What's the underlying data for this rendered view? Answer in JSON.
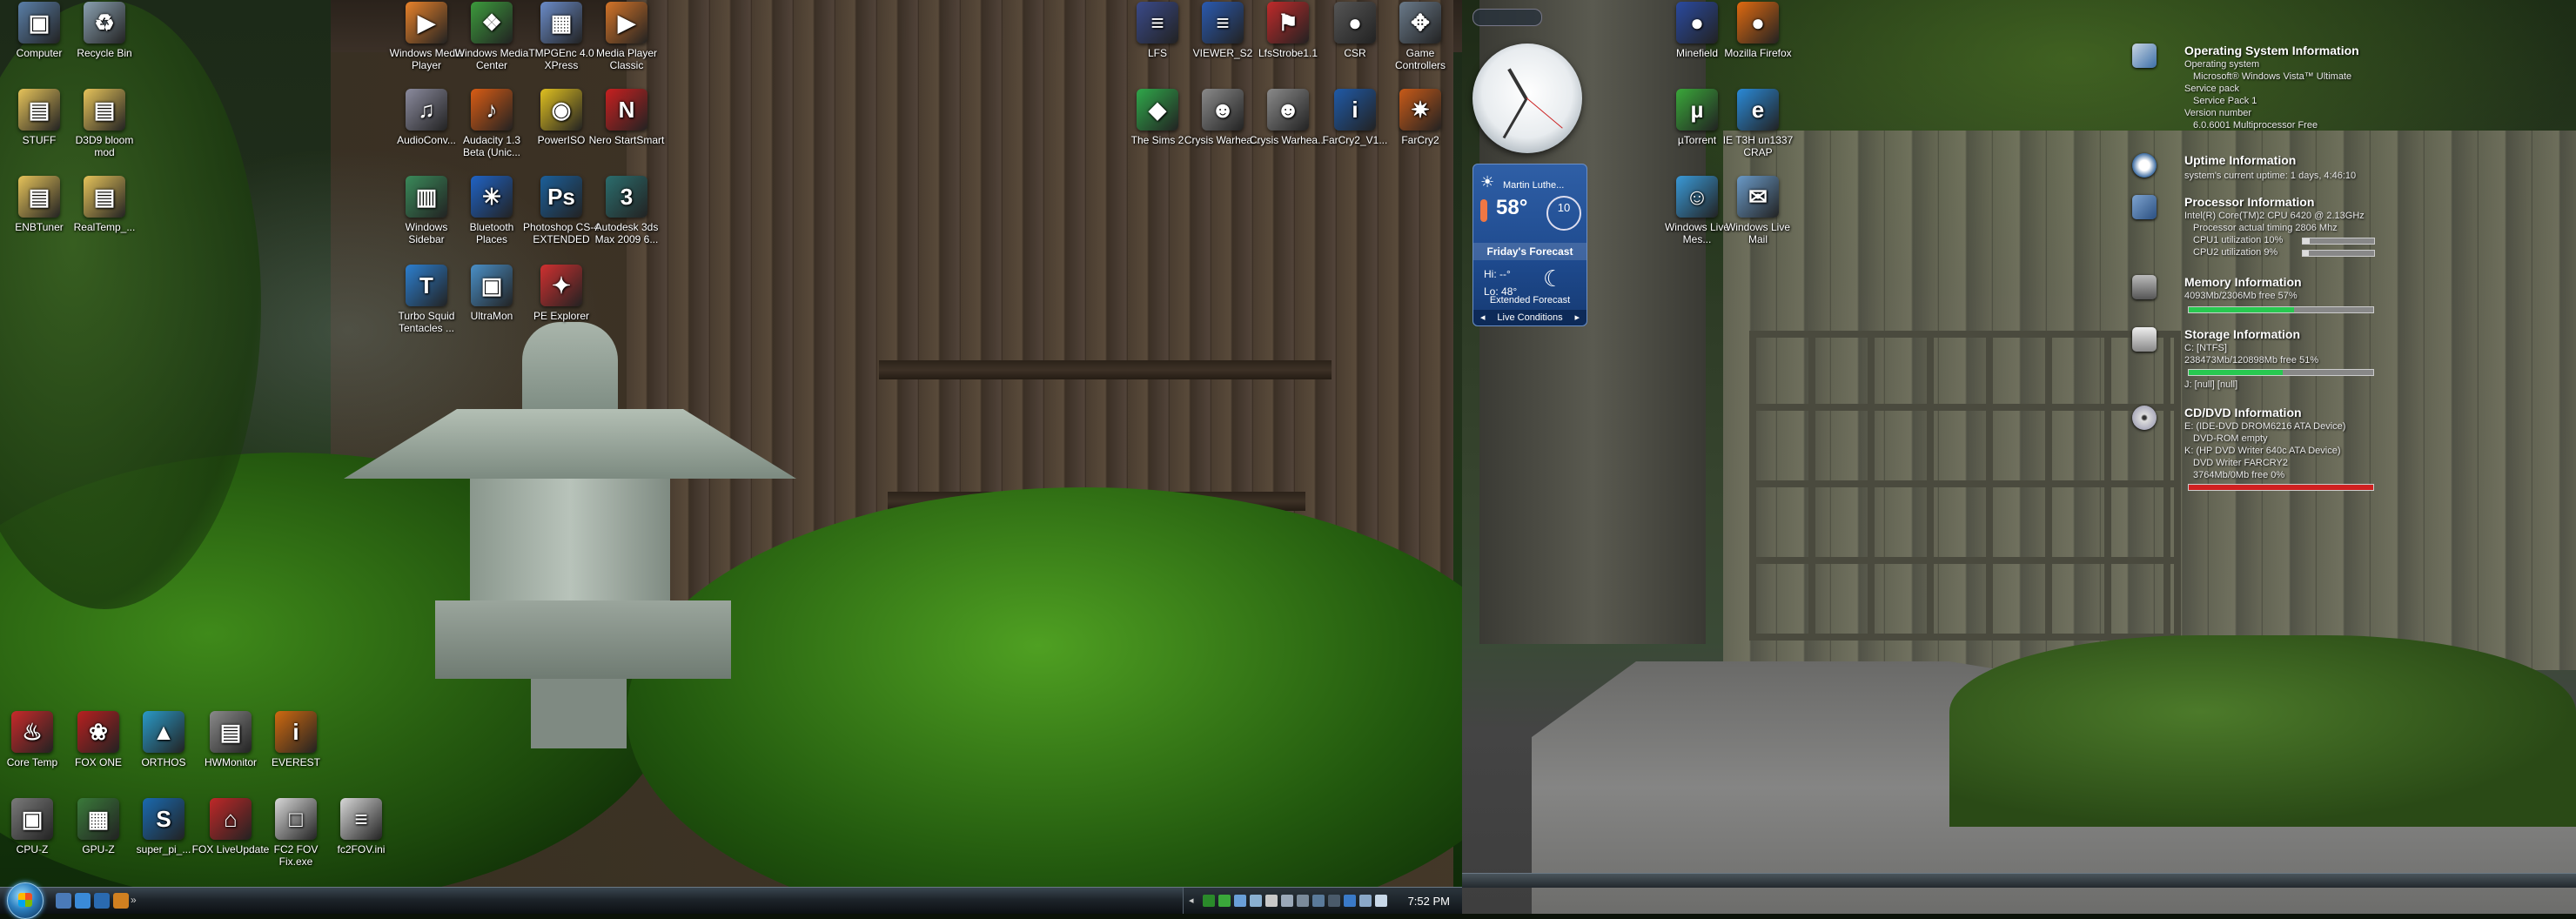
{
  "left_desktop": {
    "icons": [
      {
        "label": "Computer",
        "glyph": "▣",
        "color": "#5a7fa8"
      },
      {
        "label": "Recycle Bin",
        "glyph": "♻",
        "color": "#8aa0b0"
      },
      {
        "label": "STUFF",
        "glyph": "▤",
        "color": "#e6c35a"
      },
      {
        "label": "D3D9 bloom mod",
        "glyph": "▤",
        "color": "#e6c35a"
      },
      {
        "label": "ENBTuner",
        "glyph": "▤",
        "color": "#e6c35a"
      },
      {
        "label": "RealTemp_...",
        "glyph": "▤",
        "color": "#e6c35a"
      },
      {
        "label": "Windows Media Player",
        "glyph": "▶",
        "color": "#e8822a"
      },
      {
        "label": "Windows Media Center",
        "glyph": "❖",
        "color": "#3c9b3c"
      },
      {
        "label": "TMPGEnc 4.0 XPress",
        "glyph": "▦",
        "color": "#6b8cc9"
      },
      {
        "label": "Media Player Classic",
        "glyph": "▶",
        "color": "#d47428"
      },
      {
        "label": "AudioConv...",
        "glyph": "♫",
        "color": "#8b8b9e"
      },
      {
        "label": "Audacity 1.3 Beta (Unic...",
        "glyph": "♪",
        "color": "#d95c14"
      },
      {
        "label": "PowerISO",
        "glyph": "◉",
        "color": "#e0c020"
      },
      {
        "label": "Nero StartSmart",
        "glyph": "N",
        "color": "#c82020"
      },
      {
        "label": "Windows Sidebar",
        "glyph": "▥",
        "color": "#3a8a5a"
      },
      {
        "label": "Bluetooth Places",
        "glyph": "✳",
        "color": "#1f63c6"
      },
      {
        "label": "Photoshop CS-4 EXTENDED",
        "glyph": "Ps",
        "color": "#1b5f9a"
      },
      {
        "label": "Autodesk 3ds Max 2009 6...",
        "glyph": "3",
        "color": "#2b6d6d"
      },
      {
        "label": "Turbo Squid Tentacles ...",
        "glyph": "T",
        "color": "#2c7fd0"
      },
      {
        "label": "UltraMon",
        "glyph": "▣",
        "color": "#4a90c8"
      },
      {
        "label": "PE Explorer",
        "glyph": "✦",
        "color": "#d03030"
      },
      {
        "label": "LFS",
        "glyph": "≡",
        "color": "#3a4a8a"
      },
      {
        "label": "VIEWER_S2",
        "glyph": "≡",
        "color": "#2a5ab0"
      },
      {
        "label": "LfsStrobe1.1",
        "glyph": "⚑",
        "color": "#c02a2a"
      },
      {
        "label": "CSR",
        "glyph": "●",
        "color": "#555"
      },
      {
        "label": "Game Controllers",
        "glyph": "✥",
        "color": "#6a7a8a"
      },
      {
        "label": "The Sims 2",
        "glyph": "◆",
        "color": "#2fa84a"
      },
      {
        "label": "Crysis Warhea...",
        "glyph": "☻",
        "color": "#8a8a8a"
      },
      {
        "label": "Crysis Warhea...",
        "glyph": "☻",
        "color": "#8a8a8a"
      },
      {
        "label": "FarCry2_V1...",
        "glyph": "i",
        "color": "#1f5aa8"
      },
      {
        "label": "FarCry2",
        "glyph": "✷",
        "color": "#c85a18"
      },
      {
        "label": "Core Temp",
        "glyph": "♨",
        "color": "#c82a2a"
      },
      {
        "label": "FOX ONE",
        "glyph": "❀",
        "color": "#b82020"
      },
      {
        "label": "ORTHOS",
        "glyph": "▲",
        "color": "#2a9ac8"
      },
      {
        "label": "HWMonitor",
        "glyph": "▤",
        "color": "#8a8a8a"
      },
      {
        "label": "EVEREST",
        "glyph": "i",
        "color": "#d06a10"
      },
      {
        "label": "CPU-Z",
        "glyph": "▣",
        "color": "#7a7a7a"
      },
      {
        "label": "GPU-Z",
        "glyph": "▦",
        "color": "#3a7a3a"
      },
      {
        "label": "super_pi_...",
        "glyph": "S",
        "color": "#1a6ab0"
      },
      {
        "label": "FOX LiveUpdate",
        "glyph": "⌂",
        "color": "#c02828"
      },
      {
        "label": "FC2 FOV Fix.exe",
        "glyph": "□",
        "color": "#d8d8d8"
      },
      {
        "label": "fc2FOV.ini",
        "glyph": "≡",
        "color": "#d8d8d8"
      }
    ]
  },
  "right_desktop": {
    "icons": [
      {
        "label": "Minefield",
        "glyph": "●",
        "color": "#2a4aa0"
      },
      {
        "label": "Mozilla Firefox",
        "glyph": "●",
        "color": "#e06a10"
      },
      {
        "label": "µTorrent",
        "glyph": "µ",
        "color": "#3aa83a"
      },
      {
        "label": "IE T3H un1337 CRAP",
        "glyph": "e",
        "color": "#2a8ad8"
      },
      {
        "label": "Windows Live Mes...",
        "glyph": "☺",
        "color": "#3a9ad8"
      },
      {
        "label": "Windows Live Mail",
        "glyph": "✉",
        "color": "#6a9ac8"
      }
    ]
  },
  "weather_gadget": {
    "city": "Martin Luthe...",
    "temperature": "58°",
    "wind": "10",
    "forecast_title": "Friday's Forecast",
    "hi": "Hi: --°",
    "lo": "Lo: 48°",
    "extended": "Extended Forecast",
    "live": "Live Conditions"
  },
  "taskbar": {
    "time": "7:52 PM"
  },
  "sysinfo": {
    "os": {
      "title": "Operating System Information",
      "lines": [
        "Operating system",
        "Microsoft® Windows Vista™ Ultimate",
        "Service pack",
        "Service Pack 1",
        "Version number",
        "6.0.6001 Multiprocessor Free"
      ]
    },
    "uptime": {
      "title": "Uptime Information",
      "lines": [
        "system's current uptime: 1 days, 4:46:10"
      ]
    },
    "processor": {
      "title": "Processor Information",
      "lines": [
        "Intel(R) Core(TM)2 CPU       6420  @ 2.13GHz",
        "Processor actual timing 2806 Mhz",
        "CPU1 utilization     10%",
        "CPU2 utilization     9%"
      ],
      "cpu1": 10,
      "cpu2": 9
    },
    "memory": {
      "title": "Memory Information",
      "lines": [
        "4093Mb/2306Mb  free 57%"
      ],
      "free": 57
    },
    "storage": {
      "title": "Storage Information",
      "lines": [
        "C: [NTFS]",
        "238473Mb/120898Mb  free 51%",
        "J: [null]  [null]"
      ],
      "free": 51
    },
    "cddvd": {
      "title": "CD/DVD Information",
      "lines": [
        "E: (IDE-DVD DROM6216 ATA Device)",
        "DVD-ROM       empty",
        "K: (HP DVD Writer 640c ATA Device)",
        "DVD Writer       FARCRY2",
        "3764Mb/0Mb  free 0%"
      ],
      "free": 0
    }
  }
}
